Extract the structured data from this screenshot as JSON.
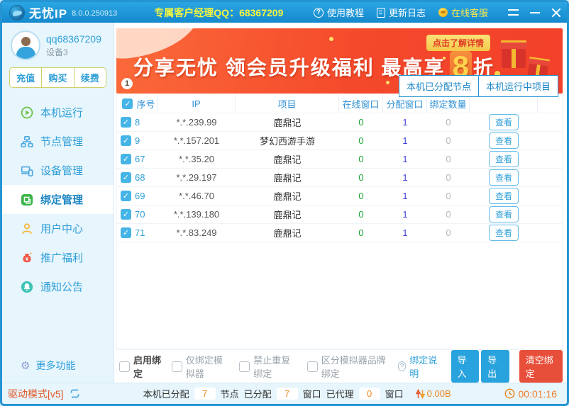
{
  "titlebar": {
    "app_name": "无忧IP",
    "version": "8.0.0.250913",
    "qq_label": "专属客户经理QQ：68367209",
    "menu": [
      {
        "label": "使用教程"
      },
      {
        "label": "更新日志"
      },
      {
        "label": "在线客服"
      }
    ]
  },
  "sidebar": {
    "username": "qq68367209",
    "device": "设备3",
    "account_buttons": [
      "充值",
      "购买",
      "续费"
    ],
    "menu": [
      {
        "label": "本机运行",
        "active": false
      },
      {
        "label": "节点管理",
        "active": false
      },
      {
        "label": "设备管理",
        "active": false
      },
      {
        "label": "绑定管理",
        "active": true
      },
      {
        "label": "用户中心",
        "active": false
      },
      {
        "label": "推广福利",
        "active": false
      },
      {
        "label": "通知公告",
        "active": false
      }
    ],
    "more_label": "更多功能",
    "driver_mode_label": "驱动模式[v5]"
  },
  "banner": {
    "headline": "分享无忧 领会员升级福利 最高享",
    "discount_digit": "8",
    "discount_suffix": "折",
    "cta_label": "点击了解详情",
    "page_indicator": "1"
  },
  "tabs": [
    {
      "label": "本机已分配节点",
      "active": true
    },
    {
      "label": "本机运行中项目",
      "active": false
    }
  ],
  "table": {
    "headers": [
      "序号",
      "IP",
      "项目",
      "在线窗口",
      "分配窗口",
      "绑定数量"
    ],
    "action_label": "查看",
    "rows": [
      {
        "no": "8",
        "ip": "*.*.239.99",
        "project": "鹿鼎记",
        "online": "0",
        "assigned": "1",
        "bound": "0",
        "checked": true
      },
      {
        "no": "9",
        "ip": "*.*.157.201",
        "project": "梦幻西游手游",
        "online": "0",
        "assigned": "1",
        "bound": "0",
        "checked": true
      },
      {
        "no": "67",
        "ip": "*.*.35.20",
        "project": "鹿鼎记",
        "online": "0",
        "assigned": "1",
        "bound": "0",
        "checked": true
      },
      {
        "no": "68",
        "ip": "*.*.29.197",
        "project": "鹿鼎记",
        "online": "0",
        "assigned": "1",
        "bound": "0",
        "checked": true
      },
      {
        "no": "69",
        "ip": "*.*.46.70",
        "project": "鹿鼎记",
        "online": "0",
        "assigned": "1",
        "bound": "0",
        "checked": true
      },
      {
        "no": "70",
        "ip": "*.*.139.180",
        "project": "鹿鼎记",
        "online": "0",
        "assigned": "1",
        "bound": "0",
        "checked": true
      },
      {
        "no": "71",
        "ip": "*.*.83.249",
        "project": "鹿鼎记",
        "online": "0",
        "assigned": "1",
        "bound": "0",
        "checked": true
      }
    ]
  },
  "controls": {
    "checkboxes": [
      {
        "label": "启用绑定",
        "checked": false,
        "emphasized": true
      },
      {
        "label": "仅绑定模拟器",
        "checked": false,
        "emphasized": false
      },
      {
        "label": "禁止重复绑定",
        "checked": false,
        "emphasized": false
      },
      {
        "label": "区分模拟器品牌绑定",
        "checked": false,
        "emphasized": false
      }
    ],
    "help_label": "绑定说明",
    "import_label": "导入",
    "export_label": "导出",
    "clear_label": "清空绑定"
  },
  "statusbar": {
    "assigned_label": "本机已分配",
    "assigned_nodes": "7",
    "nodes_label": "节点",
    "assigned_windows_label": "已分配",
    "assigned_windows": "7",
    "windows_label": "窗口",
    "proxied_label": "已代理",
    "proxied_windows": "0",
    "windows_label2": "窗口",
    "traffic": "0.00B",
    "timer": "00:01:16"
  },
  "colors": {
    "titlebar_blue": "#1b95d4",
    "accent_blue": "#2e9fd8",
    "highlight_yellow": "#f6f63e",
    "banner_orange": "#f4492b",
    "cta_yellow": "#f3c84a",
    "danger_red": "#e84f3a",
    "status_orange": "#f08519",
    "green_value": "#18a532",
    "blue_value": "#4343dd",
    "sidebar_bg": "#e7f5fd"
  }
}
